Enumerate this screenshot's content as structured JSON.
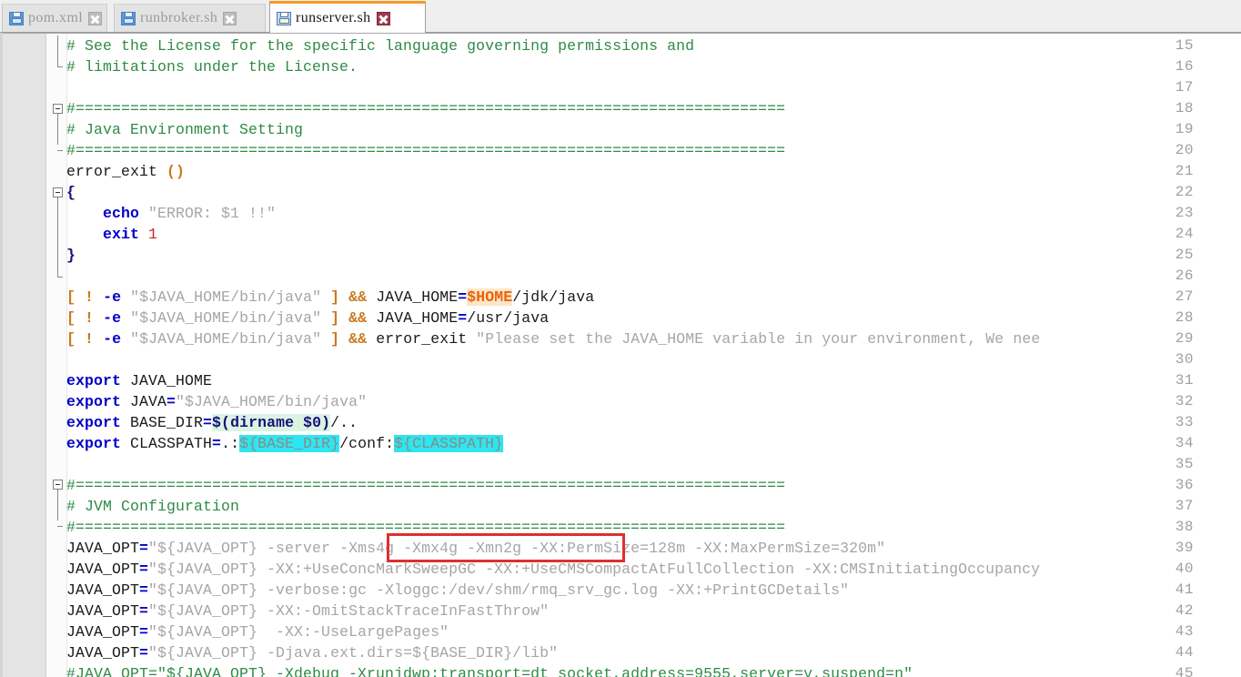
{
  "window": {
    "title": "runserver.sh"
  },
  "tabs": [
    {
      "label": "pom.xml",
      "icon": "file-icon",
      "close_icon": "close-icon",
      "active": false
    },
    {
      "label": "runbroker.sh",
      "icon": "file-icon",
      "close_icon": "close-icon",
      "active": false
    },
    {
      "label": "runserver.sh",
      "icon": "floppy-icon",
      "close_icon": "close-icon",
      "active": true
    }
  ],
  "editor": {
    "first_line": 15,
    "last_line": 45,
    "line_numbers": [
      "15",
      "16",
      "17",
      "18",
      "19",
      "20",
      "21",
      "22",
      "23",
      "24",
      "25",
      "26",
      "27",
      "28",
      "29",
      "30",
      "31",
      "32",
      "33",
      "34",
      "35",
      "36",
      "37",
      "38",
      "39",
      "40",
      "41",
      "42",
      "43",
      "44",
      "45"
    ],
    "lines": [
      {
        "n": "15",
        "text": "# See the License for the specific language governing permissions and"
      },
      {
        "n": "16",
        "text": "# limitations under the License."
      },
      {
        "n": "17",
        "text": ""
      },
      {
        "n": "18",
        "text": "#=============================================================================="
      },
      {
        "n": "19",
        "text": "# Java Environment Setting"
      },
      {
        "n": "20",
        "text": "#=============================================================================="
      },
      {
        "n": "21",
        "text": "error_exit ()"
      },
      {
        "n": "22",
        "text": "{"
      },
      {
        "n": "23",
        "text": "    echo \"ERROR: $1 !!\""
      },
      {
        "n": "24",
        "text": "    exit 1"
      },
      {
        "n": "25",
        "text": "}"
      },
      {
        "n": "26",
        "text": ""
      },
      {
        "n": "27",
        "text": "[ ! -e \"$JAVA_HOME/bin/java\" ] && JAVA_HOME=$HOME/jdk/java"
      },
      {
        "n": "28",
        "text": "[ ! -e \"$JAVA_HOME/bin/java\" ] && JAVA_HOME=/usr/java"
      },
      {
        "n": "29",
        "text": "[ ! -e \"$JAVA_HOME/bin/java\" ] && error_exit \"Please set the JAVA_HOME variable in your environment, We nee"
      },
      {
        "n": "30",
        "text": ""
      },
      {
        "n": "31",
        "text": "export JAVA_HOME"
      },
      {
        "n": "32",
        "text": "export JAVA=\"$JAVA_HOME/bin/java\""
      },
      {
        "n": "33",
        "text": "export BASE_DIR=$(dirname $0)/.."
      },
      {
        "n": "34",
        "text": "export CLASSPATH=.:${BASE_DIR}/conf:${CLASSPATH}"
      },
      {
        "n": "35",
        "text": ""
      },
      {
        "n": "36",
        "text": "#=============================================================================="
      },
      {
        "n": "37",
        "text": "# JVM Configuration"
      },
      {
        "n": "38",
        "text": "#=============================================================================="
      },
      {
        "n": "39",
        "text": "JAVA_OPT=\"${JAVA_OPT} -server -Xms4g -Xmx4g -Xmn2g -XX:PermSize=128m -XX:MaxPermSize=320m\""
      },
      {
        "n": "40",
        "text": "JAVA_OPT=\"${JAVA_OPT} -XX:+UseConcMarkSweepGC -XX:+UseCMSCompactAtFullCollection -XX:CMSInitiatingOccupancy"
      },
      {
        "n": "41",
        "text": "JAVA_OPT=\"${JAVA_OPT} -verbose:gc -Xloggc:/dev/shm/rmq_srv_gc.log -XX:+PrintGCDetails\""
      },
      {
        "n": "42",
        "text": "JAVA_OPT=\"${JAVA_OPT} -XX:-OmitStackTraceInFastThrow\""
      },
      {
        "n": "43",
        "text": "JAVA_OPT=\"${JAVA_OPT}  -XX:-UseLargePages\""
      },
      {
        "n": "44",
        "text": "JAVA_OPT=\"${JAVA_OPT} -Djava.ext.dirs=${BASE_DIR}/lib\""
      },
      {
        "n": "45",
        "text": "#JAVA_OPT=\"${JAVA_OPT} -Xdebug -Xrunjdwp:transport=dt_socket,address=9555,server=y,suspend=n\""
      }
    ],
    "annotation": {
      "type": "red-rectangle",
      "color": "#e03030",
      "highlighted_text": "-Xms4g -Xmx4g -Xmn2g",
      "on_line": "39"
    },
    "highlights": {
      "peach": "$HOME",
      "green": "$(dirname $0)",
      "cyan": [
        "${BASE_DIR}",
        "${CLASSPATH}"
      ]
    }
  },
  "colors": {
    "comment": "#2e8b46",
    "keyword": "#0000c8",
    "string": "#a6a6a6",
    "operator": "#b8860b",
    "number": "#d02020",
    "cyan_highlight": "#2ee6f0",
    "green_highlight": "#ddf3e2",
    "peach_highlight": "#fde6c8",
    "annotation_red": "#e03030",
    "active_tab_accent": "#f79a2b",
    "gutter_bg": "#e4e4e4"
  }
}
